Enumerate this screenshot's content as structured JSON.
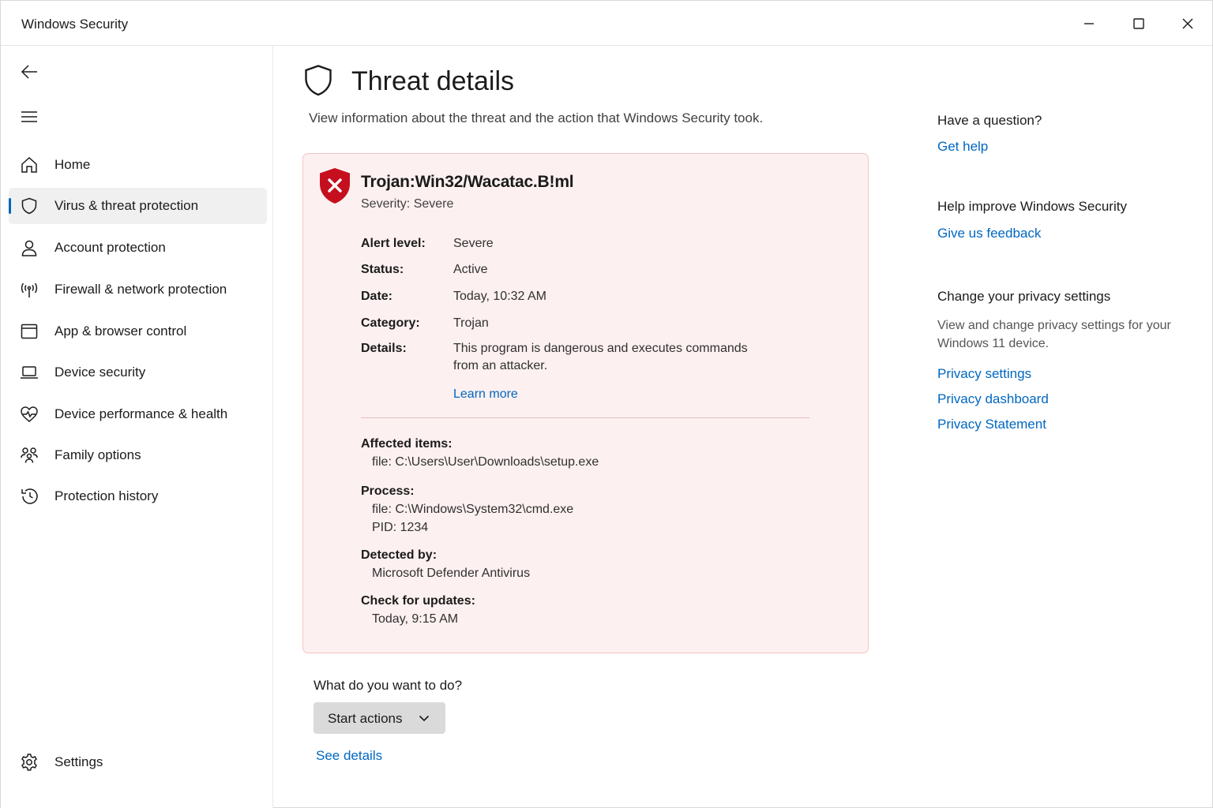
{
  "window": {
    "title": "Windows Security",
    "controls": {
      "minimize": "minimize",
      "maximize": "maximize",
      "close": "close"
    }
  },
  "sidebar": {
    "items": [
      {
        "label": "Home",
        "icon": "home-icon"
      },
      {
        "label": "Virus & threat protection",
        "icon": "shield-icon",
        "selected": true
      },
      {
        "label": "Account protection",
        "icon": "person-icon"
      },
      {
        "label": "Firewall & network protection",
        "icon": "antenna-icon"
      },
      {
        "label": "App & browser control",
        "icon": "browser-window-icon"
      },
      {
        "label": "Device security",
        "icon": "laptop-icon"
      },
      {
        "label": "Device performance & health",
        "icon": "heart-pulse-icon"
      },
      {
        "label": "Family options",
        "icon": "family-icon"
      },
      {
        "label": "Protection history",
        "icon": "history-icon"
      }
    ],
    "settings": {
      "label": "Settings",
      "icon": "gear-icon"
    },
    "accent": "#0067c0"
  },
  "main": {
    "title": "Threat details",
    "description": "View information about the threat and the action that Windows Security took.",
    "threat": {
      "name": "Trojan:Win32/Wacatac.B!ml",
      "severity": "Severity: Severe",
      "fields": {
        "alert_level_label": "Alert level:",
        "alert_level": "Severe",
        "status_label": "Status:",
        "status": "Active",
        "date_label": "Date:",
        "date": "Today, 10:32 AM",
        "category_label": "Category:",
        "category": "Trojan",
        "details_label": "Details:",
        "details_line1": "This program is dangerous and executes commands",
        "details_line2": "from an attacker."
      },
      "learn_more": "Learn more",
      "affected_label": "Affected items:",
      "affected_value": "file: C:\\Users\\User\\Downloads\\setup.exe",
      "process_label": "Process:",
      "process_file": "file: C:\\Windows\\System32\\cmd.exe",
      "process_pid": "PID: 1234",
      "detected_label": "Detected by:",
      "detected_value": "Microsoft Defender Antivirus",
      "updates_label": "Check for updates:",
      "updates_value": "Today, 9:15 AM",
      "card_bg": "#fdf0f0",
      "card_border": "#f2c7c7",
      "shield_color": "#c50f1f"
    },
    "question": "What do you want to do?",
    "start_actions": "Start actions",
    "see_details": "See details"
  },
  "rail": {
    "question_heading": "Have a question?",
    "get_help": "Get help",
    "improve_heading": "Help improve Windows Security",
    "feedback": "Give us feedback",
    "privacy_heading": "Change your privacy settings",
    "privacy_desc": "View and change privacy settings for your Windows 11 device.",
    "privacy_settings": "Privacy settings",
    "privacy_dashboard": "Privacy dashboard",
    "privacy_statement": "Privacy Statement"
  }
}
